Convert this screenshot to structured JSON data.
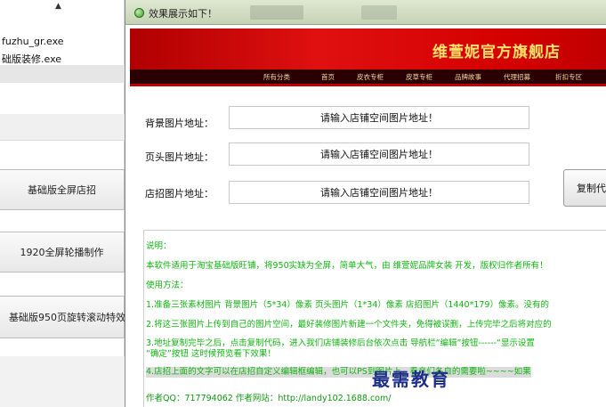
{
  "left_app": {
    "files": [
      "fuzhu_gr.exe",
      "础版装修.exe"
    ],
    "buttons": [
      "基础版全屏店招",
      "1920全屏轮播制作",
      "基础版950页旋转滚动特效"
    ]
  },
  "dialog": {
    "title": "效果展示如下！",
    "shop_name": "维萱妮官方旗舰店",
    "nav": [
      "所有分类",
      "首页",
      "皮衣专柜",
      "皮草专柜",
      "品牌故事",
      "代理招募",
      "折扣专区"
    ],
    "fields": [
      {
        "label": "背景图片地址：",
        "placeholder": "请输入店铺空间图片地址！"
      },
      {
        "label": "页头图片地址：",
        "placeholder": "请输入店铺空间图片地址！"
      },
      {
        "label": "店招图片地址：",
        "placeholder": "请输入店铺空间图片地址！"
      }
    ],
    "copy_button": "复制代",
    "info": {
      "heading": "说明：",
      "intro": "本软件适用于淘宝基础版旺铺，将950实缺为全屏，简单大气，由 维萱妮品牌女装 开发，版权归作者所有！",
      "method": "使用方法：",
      "step1": "1.准备三张素材图片   背景图片（5*34）像素   页头图片（1*34）像素   店招图片（1440*179）像素。没有的",
      "step2": "2.将这三张图片上传到自己的图片空间，最好装修图片新建一个文件夹，免得被误删，上传完毕之后将对应的",
      "step3a": "3.地址复制完毕之后，点击复制代码，进入我们店铺装修后台依次点击 导航栏“编辑”按钮------“显示设置",
      "step3b": "  “确定”按钮 这时候预览看下效果！",
      "step4": "4.店招上面的文字可以在店招自定义编辑框编辑，也可以PS到图片上，看亲们各自的需要啦~~~~如果",
      "author": "作者QQ：717794062       作者网站：http://landy102.1688.com/"
    }
  },
  "watermark": "最需教育",
  "colors": {
    "banner": "#cc0000",
    "shop_name": "#ffe36a",
    "nav_bg": "#2a0000",
    "info_text": "#12b312",
    "watermark": "#1e2f8a"
  }
}
